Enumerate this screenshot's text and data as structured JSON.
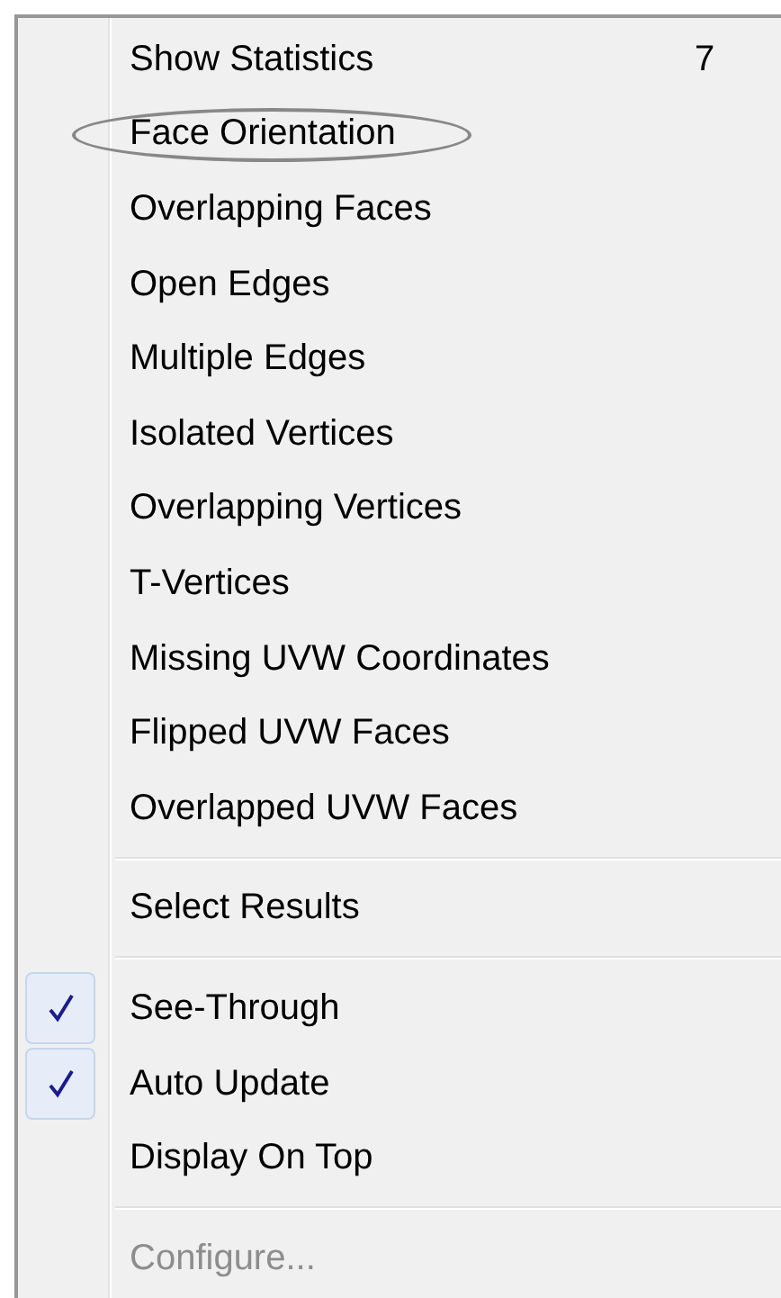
{
  "menu": {
    "sections": [
      {
        "items": [
          {
            "label": "Show Statistics",
            "shortcut": "7",
            "checked": false,
            "disabled": false,
            "circled": false
          },
          {
            "label": "Face Orientation",
            "checked": false,
            "disabled": false,
            "circled": true
          },
          {
            "label": "Overlapping Faces",
            "checked": false,
            "disabled": false,
            "circled": false
          },
          {
            "label": "Open Edges",
            "checked": false,
            "disabled": false,
            "circled": false
          },
          {
            "label": "Multiple Edges",
            "checked": false,
            "disabled": false,
            "circled": false
          },
          {
            "label": "Isolated Vertices",
            "checked": false,
            "disabled": false,
            "circled": false
          },
          {
            "label": "Overlapping Vertices",
            "checked": false,
            "disabled": false,
            "circled": false
          },
          {
            "label": "T-Vertices",
            "checked": false,
            "disabled": false,
            "circled": false
          },
          {
            "label": "Missing UVW Coordinates",
            "checked": false,
            "disabled": false,
            "circled": false
          },
          {
            "label": "Flipped UVW Faces",
            "checked": false,
            "disabled": false,
            "circled": false
          },
          {
            "label": "Overlapped UVW Faces",
            "checked": false,
            "disabled": false,
            "circled": false
          }
        ]
      },
      {
        "items": [
          {
            "label": "Select Results",
            "checked": false,
            "disabled": false,
            "circled": false
          }
        ]
      },
      {
        "items": [
          {
            "label": "See-Through",
            "checked": true,
            "disabled": false,
            "circled": false
          },
          {
            "label": "Auto Update",
            "checked": true,
            "disabled": false,
            "circled": false
          },
          {
            "label": "Display On Top",
            "checked": false,
            "disabled": false,
            "circled": false
          }
        ]
      },
      {
        "items": [
          {
            "label": "Configure...",
            "checked": false,
            "disabled": true,
            "circled": false
          }
        ]
      }
    ]
  }
}
